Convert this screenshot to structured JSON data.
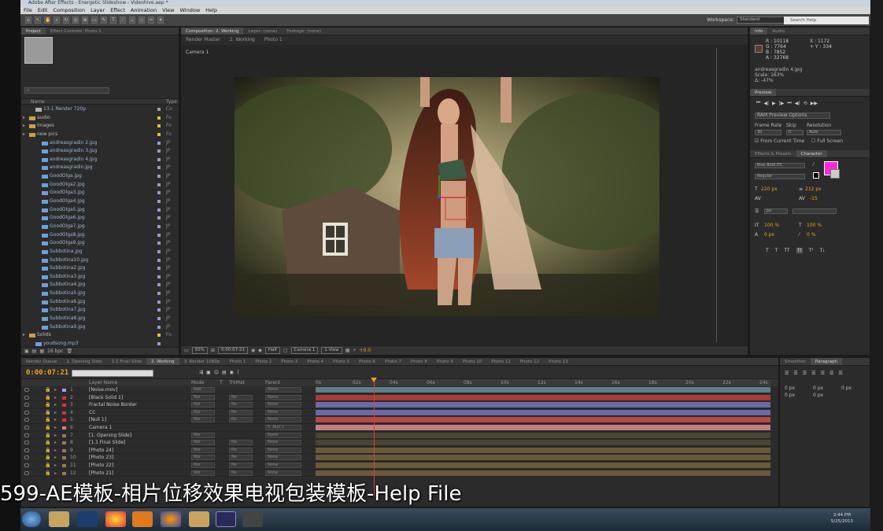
{
  "titlebar": {
    "title": "Adobe After Effects - Energetic Slideshow - Videohive.aep *"
  },
  "menu": [
    "File",
    "Edit",
    "Composition",
    "Layer",
    "Effect",
    "Animation",
    "View",
    "Window",
    "Help"
  ],
  "toolbar": {
    "workspace_label": "Workspace:",
    "workspace_value": "Standard",
    "search_placeholder": "Search Help"
  },
  "project": {
    "tabs": [
      "Project",
      "Effect Controls: Photo 1"
    ],
    "columns": {
      "name": "Name",
      "type": "Type"
    },
    "items": [
      {
        "name": "13-1 Render 720p",
        "kind": "comp",
        "indent": 1,
        "type": "Co",
        "color": "#a0a0a0"
      },
      {
        "name": "audio",
        "kind": "folder",
        "indent": 0,
        "type": "Fo",
        "color": "#e0c030"
      },
      {
        "name": "Images",
        "kind": "folder",
        "indent": 0,
        "type": "Fo",
        "color": "#e0c030"
      },
      {
        "name": "new pics",
        "kind": "folder",
        "indent": 0,
        "type": "Fo",
        "color": "#e0c030"
      },
      {
        "name": "andreasgradin 2.jpg",
        "kind": "file",
        "indent": 2,
        "type": "JP",
        "color": "#9a9ad0"
      },
      {
        "name": "andreasgradin 3.jpg",
        "kind": "file",
        "indent": 2,
        "type": "JP",
        "color": "#9a9ad0"
      },
      {
        "name": "andreasgradin 4.jpg",
        "kind": "file",
        "indent": 2,
        "type": "JP",
        "color": "#9a9ad0"
      },
      {
        "name": "andreasgradin.jpg",
        "kind": "file",
        "indent": 2,
        "type": "JP",
        "color": "#9a9ad0"
      },
      {
        "name": "GoodOlga.jpg",
        "kind": "file",
        "indent": 2,
        "type": "JP",
        "color": "#9a9ad0"
      },
      {
        "name": "GoodOlga2.jpg",
        "kind": "file",
        "indent": 2,
        "type": "JP",
        "color": "#9a9ad0"
      },
      {
        "name": "GoodOlga3.jpg",
        "kind": "file",
        "indent": 2,
        "type": "JP",
        "color": "#9a9ad0"
      },
      {
        "name": "GoodOlga4.jpg",
        "kind": "file",
        "indent": 2,
        "type": "JP",
        "color": "#9a9ad0"
      },
      {
        "name": "GoodOlga5.jpg",
        "kind": "file",
        "indent": 2,
        "type": "JP",
        "color": "#9a9ad0"
      },
      {
        "name": "GoodOlga6.jpg",
        "kind": "file",
        "indent": 2,
        "type": "JP",
        "color": "#9a9ad0"
      },
      {
        "name": "GoodOlga7.jpg",
        "kind": "file",
        "indent": 2,
        "type": "JP",
        "color": "#9a9ad0"
      },
      {
        "name": "GoodOlga8.jpg",
        "kind": "file",
        "indent": 2,
        "type": "JP",
        "color": "#9a9ad0"
      },
      {
        "name": "GoodOlga9.jpg",
        "kind": "file",
        "indent": 2,
        "type": "JP",
        "color": "#9a9ad0"
      },
      {
        "name": "Subbotina.jpg",
        "kind": "file",
        "indent": 2,
        "type": "JP",
        "color": "#9a9ad0"
      },
      {
        "name": "Subbotina10.jpg",
        "kind": "file",
        "indent": 2,
        "type": "JP",
        "color": "#9a9ad0"
      },
      {
        "name": "Subbotina2.jpg",
        "kind": "file",
        "indent": 2,
        "type": "JP",
        "color": "#9a9ad0"
      },
      {
        "name": "Subbotina3.jpg",
        "kind": "file",
        "indent": 2,
        "type": "JP",
        "color": "#9a9ad0"
      },
      {
        "name": "Subbotina4.jpg",
        "kind": "file",
        "indent": 2,
        "type": "JP",
        "color": "#9a9ad0"
      },
      {
        "name": "Subbotina5.jpg",
        "kind": "file",
        "indent": 2,
        "type": "JP",
        "color": "#9a9ad0"
      },
      {
        "name": "Subbotina6.jpg",
        "kind": "file",
        "indent": 2,
        "type": "JP",
        "color": "#9a9ad0"
      },
      {
        "name": "Subbotina7.jpg",
        "kind": "file",
        "indent": 2,
        "type": "JP",
        "color": "#9a9ad0"
      },
      {
        "name": "Subbotina8.jpg",
        "kind": "file",
        "indent": 2,
        "type": "JP",
        "color": "#9a9ad0"
      },
      {
        "name": "Subbotina9.jpg",
        "kind": "file",
        "indent": 2,
        "type": "JP",
        "color": "#9a9ad0"
      },
      {
        "name": "Solids",
        "kind": "folder",
        "indent": 0,
        "type": "Fo",
        "color": "#e0c030"
      },
      {
        "name": "youdsong.mp3",
        "kind": "file",
        "indent": 1,
        "type": "",
        "color": "#9a9ad0"
      }
    ],
    "footer_bpc": "16 bpc"
  },
  "comp": {
    "tabs": [
      "Composition: 2. Working",
      "Layer: (none)",
      "Footage: (none)"
    ],
    "subtabs": [
      "Render Master",
      "2. Working",
      "Photo 1"
    ],
    "camera_label": "Camera 1",
    "footer": {
      "zoom": "50%",
      "timecode": "0:00:07:21",
      "resolution": "Half",
      "camera": "Camera 1",
      "view": "1 View",
      "exposure": "+0.0"
    }
  },
  "info": {
    "tabs": [
      "Info",
      "Audio"
    ],
    "r": "R : 10118",
    "g": "G : 7764",
    "b": "B : 7852",
    "a": "A : 32768",
    "x": "X : 1172",
    "y": "+ Y : 334",
    "file": "andreasgradin 4.jpg",
    "scale": "Scale: 163%",
    "delta": "Δ: -47%",
    "swatch_color": "#5a3a30"
  },
  "preview": {
    "tab": "Preview",
    "ram_options": "RAM Preview Options",
    "frame_rate_label": "Frame Rate",
    "skip_label": "Skip",
    "resolution_label": "Resolution",
    "frame_rate": "30",
    "skip": "0",
    "resolution": "Auto",
    "from_current": "From Current Time",
    "full_screen": "Full Screen"
  },
  "character": {
    "tabs": [
      "Effects & Presets",
      "Character"
    ],
    "font": "Bias Bold ITC",
    "style": "Regular",
    "size": "220 px",
    "leading": "212 px",
    "tracking": "-15",
    "units": "px",
    "vscale": "100 %",
    "hscale": "100 %",
    "baseline": "0 px",
    "tsume": "0 %",
    "fill_color": "#ff2bd2"
  },
  "timeline": {
    "tabs": [
      "Render Queue",
      "1. Opening Slide",
      "1.1 Final Slide",
      "2. Working",
      "3. Render 1080p",
      "Photo 1",
      "Photo 2",
      "Photo 3",
      "Photo 4",
      "Photo 5",
      "Photo 6",
      "Photo 7",
      "Photo 8",
      "Photo 9",
      "Photo 10",
      "Photo 11",
      "Photo 12",
      "Photo 13"
    ],
    "active_tab": 3,
    "timecode": "0:00:07:21",
    "columns": {
      "source": "Layer Name",
      "mode": "Mode",
      "t": "T",
      "trkmat": "TrkMat",
      "parent": "Parent"
    },
    "ruler": [
      "0s",
      "02s",
      "04s",
      "06s",
      "08s",
      "10s",
      "12s",
      "14s",
      "16s",
      "18s",
      "20s",
      "22s",
      "24s"
    ],
    "layers": [
      {
        "num": "1",
        "name": "[Noise.mov]",
        "mode": "Add",
        "trk": "",
        "parent": "None",
        "label": "#a0a0ff",
        "bar": "#5d7f86"
      },
      {
        "num": "2",
        "name": "[Black Solid 1]",
        "mode": "Nor",
        "trk": "No",
        "parent": "None",
        "label": "#e03030",
        "bar": "#a83a3a"
      },
      {
        "num": "3",
        "name": "Fractal Noise Border",
        "mode": "Nor",
        "trk": "No",
        "parent": "None",
        "label": "#e03030",
        "bar": "#6a6aa8"
      },
      {
        "num": "4",
        "name": "CC",
        "mode": "Nor",
        "trk": "No",
        "parent": "None",
        "label": "#e03030",
        "bar": "#6a6aa8"
      },
      {
        "num": "5",
        "name": "[Null 1]",
        "mode": "Nor",
        "trk": "No",
        "parent": "None",
        "label": "#e03030",
        "bar": "#b84848"
      },
      {
        "num": "6",
        "name": "Camera 1",
        "mode": "",
        "trk": "",
        "parent": "5. Null 1",
        "label": "#d08080",
        "bar": "#c08080"
      },
      {
        "num": "7",
        "name": "[1. Opening Slide]",
        "mode": "Nor",
        "trk": "",
        "parent": "None",
        "label": "#9a7a50",
        "bar": "#4a4434"
      },
      {
        "num": "8",
        "name": "[1.1 Final Slide]",
        "mode": "Nor",
        "trk": "No",
        "parent": "None",
        "label": "#9a7a50",
        "bar": "#4a4434"
      },
      {
        "num": "9",
        "name": "[Photo 24]",
        "mode": "Nor",
        "trk": "No",
        "parent": "None",
        "label": "#9a7a50",
        "bar": "#6a5a3a"
      },
      {
        "num": "10",
        "name": "[Photo 23]",
        "mode": "Nor",
        "trk": "No",
        "parent": "None",
        "label": "#9a7a50",
        "bar": "#6a5a3a"
      },
      {
        "num": "11",
        "name": "[Photo 22]",
        "mode": "Nor",
        "trk": "No",
        "parent": "None",
        "label": "#9a7a50",
        "bar": "#6a5a3a"
      },
      {
        "num": "12",
        "name": "[Photo 21]",
        "mode": "Nor",
        "trk": "No",
        "parent": "None",
        "label": "#9a7a50",
        "bar": "#6a5a3a"
      }
    ]
  },
  "smoother": {
    "tabs": [
      "Smoother",
      "Paragraph"
    ],
    "values": [
      "0 px",
      "0 px",
      "0 px",
      "0 px",
      "0 px"
    ]
  },
  "caption": {
    "text": "599-AE模板-相片位移效果电视包装模板-Help File"
  },
  "taskbar": {
    "time": "2:44 PM",
    "date": "5/25/2013"
  }
}
